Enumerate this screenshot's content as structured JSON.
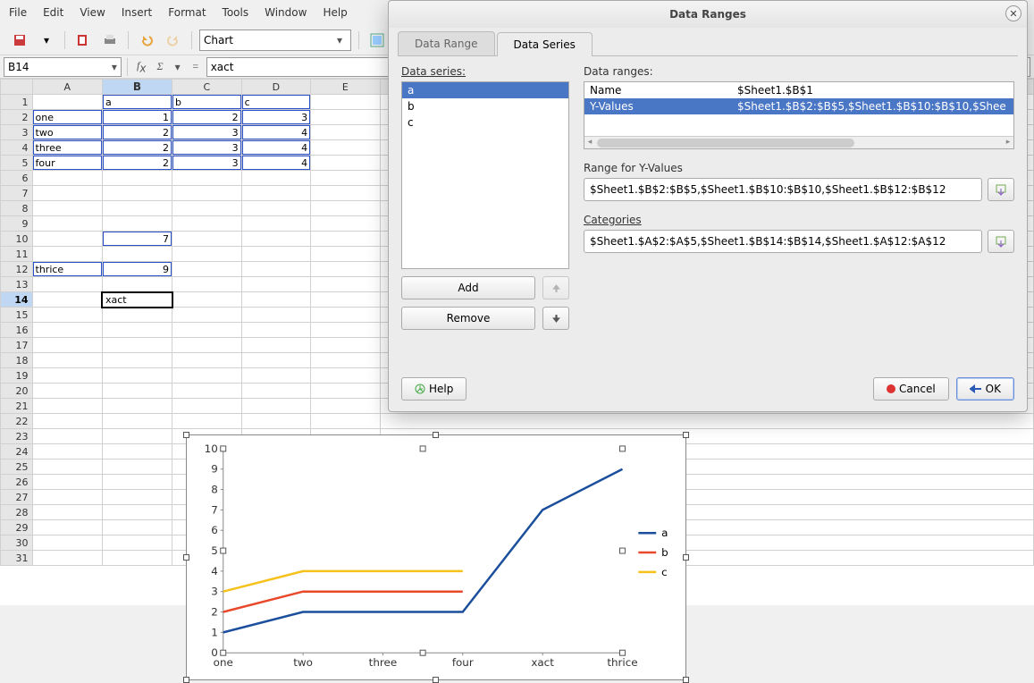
{
  "menu": {
    "items": [
      "File",
      "Edit",
      "View",
      "Insert",
      "Format",
      "Tools",
      "Window",
      "Help"
    ]
  },
  "toolbar": {
    "style_combo": "Chart"
  },
  "formula_bar": {
    "cell_ref": "B14",
    "formula": "xact"
  },
  "sheet": {
    "columns": [
      "A",
      "B",
      "C",
      "D",
      "E"
    ],
    "rows": 31,
    "cells": {
      "B1": "a",
      "C1": "b",
      "D1": "c",
      "A2": "one",
      "B2": "1",
      "C2": "2",
      "D2": "3",
      "A3": "two",
      "B3": "2",
      "C3": "3",
      "D3": "4",
      "A4": "three",
      "B4": "2",
      "C4": "3",
      "D4": "4",
      "A5": "four",
      "B5": "2",
      "C5": "3",
      "D5": "4",
      "B10": "7",
      "A12": "thrice",
      "B12": "9",
      "B14": "xact"
    },
    "active_cell": "B14",
    "selected_row": 14,
    "highlighted_col": "B"
  },
  "chart": {
    "legend": [
      "a",
      "b",
      "c"
    ],
    "y_ticks": [
      0,
      1,
      2,
      3,
      4,
      5,
      6,
      7,
      8,
      9,
      10
    ],
    "x_labels": [
      "one",
      "two",
      "three",
      "four",
      "xact",
      "thrice"
    ]
  },
  "chart_data": {
    "type": "line",
    "categories": [
      "one",
      "two",
      "three",
      "four",
      "xact",
      "thrice"
    ],
    "series": [
      {
        "name": "a",
        "values": [
          1,
          2,
          2,
          2,
          7,
          9
        ],
        "color": "#1b4f9c"
      },
      {
        "name": "b",
        "values": [
          2,
          3,
          3,
          3,
          null,
          null
        ],
        "color": "#e8492a"
      },
      {
        "name": "c",
        "values": [
          3,
          4,
          4,
          4,
          null,
          null
        ],
        "color": "#f5c11a"
      }
    ],
    "ylim": [
      0,
      10
    ],
    "xlabel": "",
    "ylabel": "",
    "title": ""
  },
  "dialog": {
    "title": "Data Ranges",
    "tabs": {
      "range": "Data Range",
      "series": "Data Series",
      "active": "series"
    },
    "series_label": "Data series:",
    "series_items": [
      "a",
      "b",
      "c"
    ],
    "series_selected": "a",
    "add_label": "Add",
    "remove_label": "Remove",
    "ranges_label": "Data ranges:",
    "ranges_table": [
      {
        "k": "Name",
        "v": "$Sheet1.$B$1"
      },
      {
        "k": "Y-Values",
        "v": "$Sheet1.$B$2:$B$5,$Sheet1.$B$10:$B$10,$Shee"
      }
    ],
    "ranges_selected": 1,
    "range_for_label": "Range for Y-Values",
    "range_for_value": "$Sheet1.$B$2:$B$5,$Sheet1.$B$10:$B$10,$Sheet1.$B$12:$B$12",
    "categories_label": "Categories",
    "categories_value": "$Sheet1.$A$2:$A$5,$Sheet1.$B$14:$B$14,$Sheet1.$A$12:$A$12",
    "help_label": "Help",
    "cancel_label": "Cancel",
    "ok_label": "OK"
  }
}
